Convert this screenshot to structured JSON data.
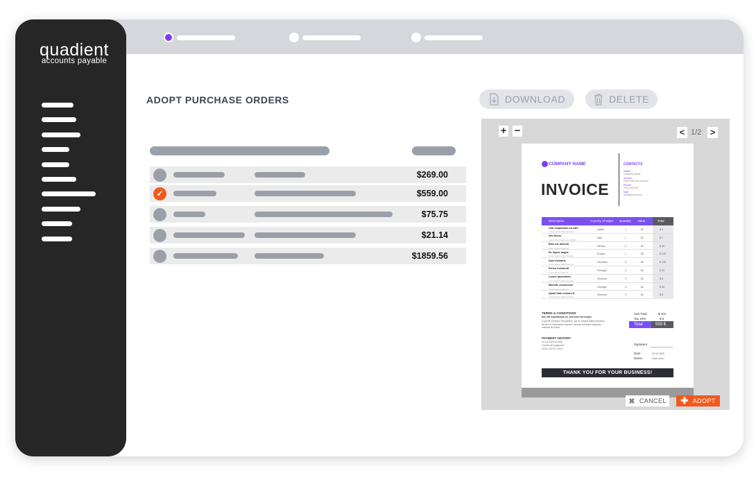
{
  "brand": {
    "name": "quadient",
    "subtitle": "accounts payable"
  },
  "page": {
    "title": "ADOPT PURCHASE ORDERS"
  },
  "toolbar": {
    "download_label": "DOWNLOAD",
    "delete_label": "DELETE"
  },
  "orders": [
    {
      "amount": "$269.00",
      "checked": false
    },
    {
      "amount": "$559.00",
      "checked": true
    },
    {
      "amount": "$75.75",
      "checked": false
    },
    {
      "amount": "$21.14",
      "checked": false
    },
    {
      "amount": "$1859.56",
      "checked": false
    }
  ],
  "viewer": {
    "zoom_in": "+",
    "zoom_out": "−",
    "page_indicator": "1/2",
    "prev": "<",
    "next": ">"
  },
  "invoice": {
    "company": "COMPANY NAME",
    "heading": "INVOICE",
    "contacts_title": "CONTACTS",
    "contacts": [
      {
        "label": "Name",
        "value": "Company Name"
      },
      {
        "label": "Adress",
        "value": "1800 lorem ips sit lorem"
      },
      {
        "label": "Phone",
        "value": "+000 000 000"
      },
      {
        "label": "Mail",
        "value": "email@email.com"
      }
    ],
    "columns": [
      "Description",
      "Country of origin",
      "Quantity",
      "Value",
      "Total"
    ],
    "items": [
      {
        "name": "Unit exquisitum ea nam",
        "sub": "Lorem ipsum dolor sit amet",
        "country": "Latvia",
        "qty": "1",
        "value": "$1",
        "total": "$ 3"
      },
      {
        "name": "Nec facos",
        "sub": "Lorem ipsum dolor sit, adipisci",
        "country": "Italy",
        "qty": "1",
        "value": "$1",
        "total": "$ 1"
      },
      {
        "name": "Eam est deleniti",
        "sub": "Lorem ipsum dolor sit",
        "country": "Mexico",
        "qty": "4",
        "value": "$2",
        "total": "$ 30"
      },
      {
        "name": "Ex impes augue",
        "sub": "Lorem ipsum dolor sit amet",
        "country": "Russia",
        "qty": "1",
        "value": "$3",
        "total": "$ 245"
      },
      {
        "name": "Duis deleatrix",
        "sub": "Lorem ipsum dolor sit amet",
        "country": "Denmark",
        "qty": "3",
        "value": "$4",
        "total": "$ 135"
      },
      {
        "name": "Fenen eonsmult",
        "sub": "Lorem ipsum dolor sit",
        "country": "Portugal",
        "qty": "1",
        "value": "$1",
        "total": "$ 20"
      },
      {
        "name": "Lorem ipsumdum",
        "sub": "Lorem ipsum dolor sit amet",
        "country": "Slovenia",
        "qty": "3",
        "value": "$1",
        "total": "$ 6"
      },
      {
        "name": "Mdestie consectum",
        "sub": "Lorem ipsum dolor sit",
        "country": "Portugal",
        "qty": "3",
        "value": "$1",
        "total": "$ 30"
      },
      {
        "name": "Quasi liam consecrit",
        "sub": "Lorem ipsum dolor sit amet",
        "country": "Slovenia",
        "qty": "3",
        "value": "$1",
        "total": "$ 5"
      }
    ],
    "terms_title": "TERMS & CONDITIONS",
    "terms_text": "Ius elit expetendis et, sed nisi est corpo",
    "terms_more": "A qui illit minimum temporibus, per ei volupta aliquid pertinax, sit tirex ei liberavisse assumit, ea erat nominavi antiopam volutpat sit ipsum.",
    "sub_total_label": "Sub Total",
    "sub_total_value": "$ 401",
    "tax_label": "Tax 10%",
    "tax_value": "$ 6",
    "total_label": "Total",
    "total_value": "559 $",
    "payment_title": "PAYMENT HISTORY",
    "payment_lines": [
      "12.10.2020 lo tone",
      "Credit card payment",
      "XXXX XXXX XXXX"
    ],
    "signature_label": "Signature",
    "date_label": "Date",
    "date_value": "20.04.2020",
    "name_label": "Name",
    "name_value": "Jean John",
    "thanks": "THANK YOU FOR YOUR BUSINESS!"
  },
  "actions": {
    "cancel_label": "CANCEL",
    "adopt_label": "ADOPT"
  },
  "colors": {
    "accent": "#7b3ff2",
    "adopt": "#f05a1e",
    "sidebar": "#262626"
  }
}
